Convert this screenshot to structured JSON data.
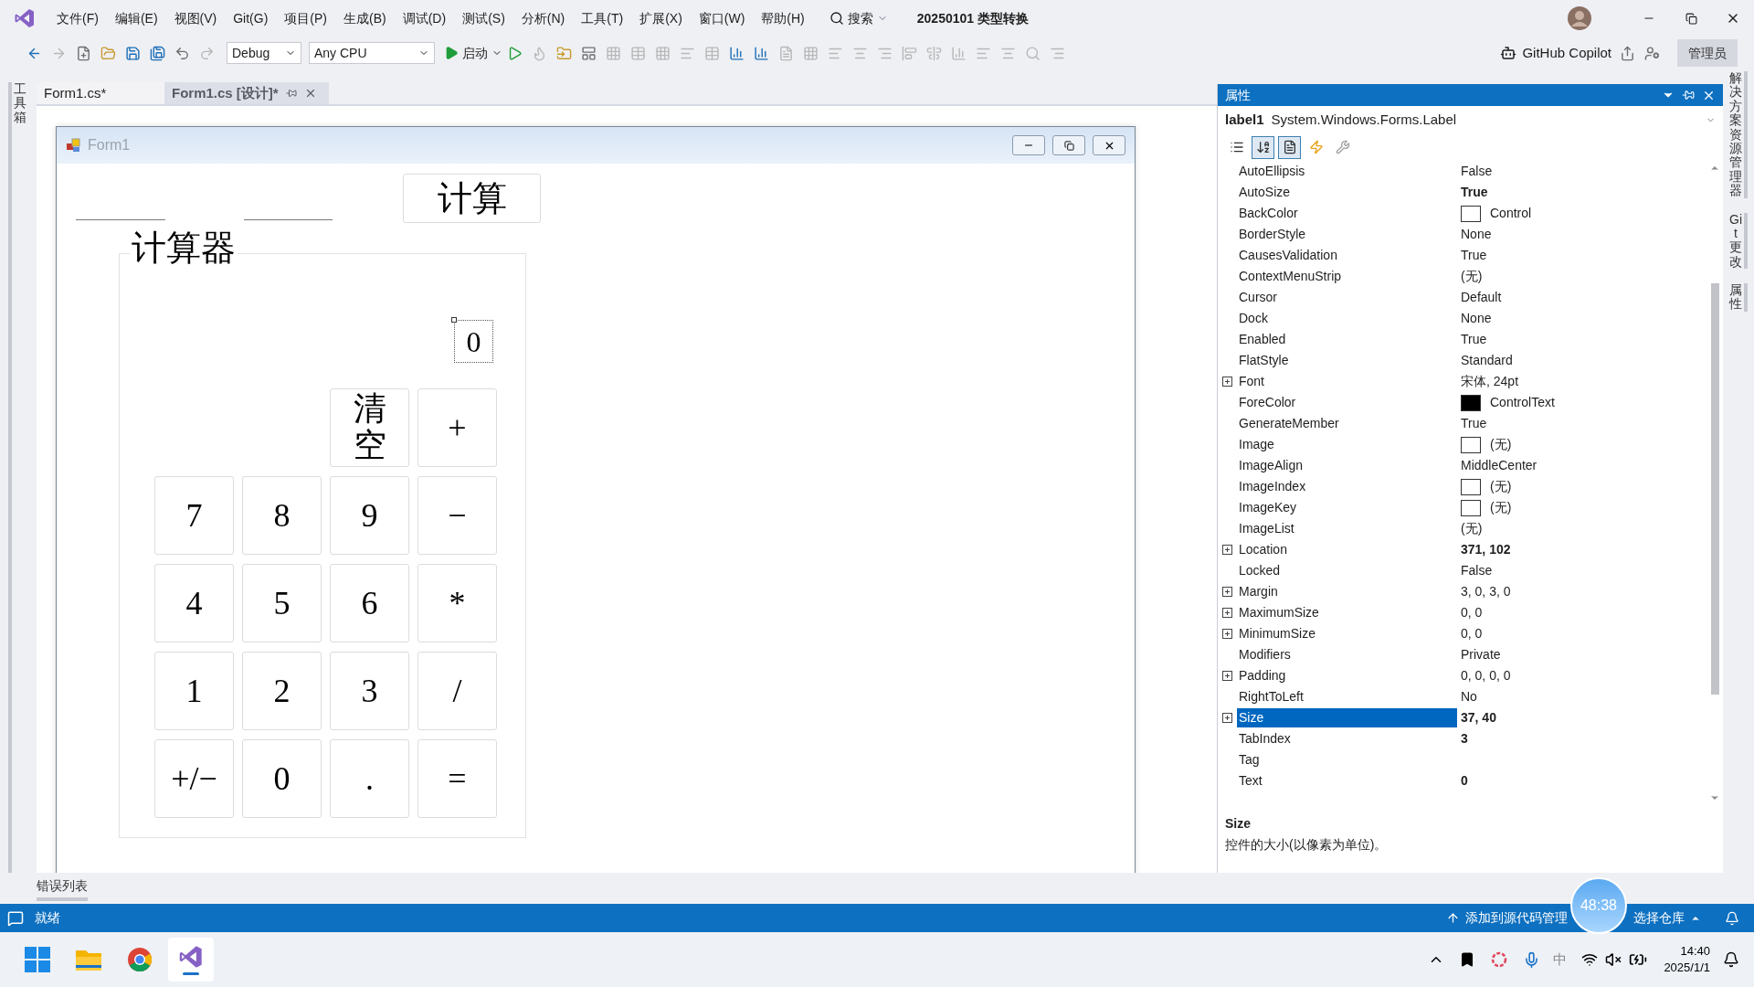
{
  "menu": [
    "文件(F)",
    "编辑(E)",
    "视图(V)",
    "Git(G)",
    "项目(P)",
    "生成(B)",
    "调试(D)",
    "测试(S)",
    "分析(N)",
    "工具(T)",
    "扩展(X)",
    "窗口(W)",
    "帮助(H)"
  ],
  "search": "搜索",
  "title": "20250101 类型转换",
  "admin": "管理员",
  "toolbar": {
    "config": "Debug",
    "platform": "Any CPU",
    "start": "启动",
    "copilot": "GitHub Copilot"
  },
  "left_strip": "工具箱",
  "doc_tabs": [
    {
      "label": "Form1.cs*",
      "selected": false
    },
    {
      "label": "Form1.cs [设计]*",
      "selected": true
    }
  ],
  "form": {
    "title": "Form1",
    "calc_button": "计算",
    "group_title": "计算器",
    "display": "0",
    "keypad": [
      [
        {
          "label": "清空",
          "kind": "word"
        },
        {
          "label": "+",
          "kind": "key"
        }
      ],
      [
        {
          "label": "7",
          "kind": "key"
        },
        {
          "label": "8",
          "kind": "key"
        },
        {
          "label": "9",
          "kind": "key"
        },
        {
          "label": "−",
          "kind": "key"
        }
      ],
      [
        {
          "label": "4",
          "kind": "key"
        },
        {
          "label": "5",
          "kind": "key"
        },
        {
          "label": "6",
          "kind": "key"
        },
        {
          "label": "*",
          "kind": "key"
        }
      ],
      [
        {
          "label": "1",
          "kind": "key"
        },
        {
          "label": "2",
          "kind": "key"
        },
        {
          "label": "3",
          "kind": "key"
        },
        {
          "label": "/",
          "kind": "key"
        }
      ],
      [
        {
          "label": "+/−",
          "kind": "key"
        },
        {
          "label": "0",
          "kind": "key"
        },
        {
          "label": ".",
          "kind": "key"
        },
        {
          "label": "=",
          "kind": "key"
        }
      ]
    ]
  },
  "properties": {
    "title": "属性",
    "object_name": "label1",
    "object_type": "System.Windows.Forms.Label",
    "view_buttons": [
      {
        "kind": "categorized",
        "selected": false
      },
      {
        "kind": "alphabetical",
        "selected": true
      },
      {
        "kind": "properties",
        "selected": true
      },
      {
        "kind": "events",
        "selected": false
      },
      {
        "kind": "property-pages",
        "selected": false
      }
    ],
    "rows": [
      {
        "name": "AutoEllipsis",
        "value": "False",
        "bold": false,
        "expandable": false,
        "selected": false
      },
      {
        "name": "AutoSize",
        "value": "True",
        "bold": true,
        "expandable": false,
        "selected": false
      },
      {
        "name": "BackColor",
        "value": "Control",
        "bold": false,
        "expandable": false,
        "selected": false,
        "color": "#ffffff"
      },
      {
        "name": "BorderStyle",
        "value": "None",
        "bold": false,
        "expandable": false,
        "selected": false
      },
      {
        "name": "CausesValidation",
        "value": "True",
        "bold": false,
        "expandable": false,
        "selected": false
      },
      {
        "name": "ContextMenuStrip",
        "value": "(无)",
        "bold": false,
        "expandable": false,
        "selected": false
      },
      {
        "name": "Cursor",
        "value": "Default",
        "bold": false,
        "expandable": false,
        "selected": false
      },
      {
        "name": "Dock",
        "value": "None",
        "bold": false,
        "expandable": false,
        "selected": false
      },
      {
        "name": "Enabled",
        "value": "True",
        "bold": false,
        "expandable": false,
        "selected": false
      },
      {
        "name": "FlatStyle",
        "value": "Standard",
        "bold": false,
        "expandable": false,
        "selected": false
      },
      {
        "name": "Font",
        "value": "宋体, 24pt",
        "bold": false,
        "expandable": true,
        "selected": false
      },
      {
        "name": "ForeColor",
        "value": "ControlText",
        "bold": false,
        "expandable": false,
        "selected": false,
        "color": "#000000"
      },
      {
        "name": "GenerateMember",
        "value": "True",
        "bold": false,
        "expandable": false,
        "selected": false
      },
      {
        "name": "Image",
        "value": "(无)",
        "bold": false,
        "expandable": false,
        "selected": false,
        "color": "#ffffff"
      },
      {
        "name": "ImageAlign",
        "value": "MiddleCenter",
        "bold": false,
        "expandable": false,
        "selected": false
      },
      {
        "name": "ImageIndex",
        "value": "(无)",
        "bold": false,
        "expandable": false,
        "selected": false,
        "color": "#ffffff"
      },
      {
        "name": "ImageKey",
        "value": "(无)",
        "bold": false,
        "expandable": false,
        "selected": false,
        "color": "#ffffff"
      },
      {
        "name": "ImageList",
        "value": "(无)",
        "bold": false,
        "expandable": false,
        "selected": false
      },
      {
        "name": "Location",
        "value": "371, 102",
        "bold": true,
        "expandable": true,
        "selected": false
      },
      {
        "name": "Locked",
        "value": "False",
        "bold": false,
        "expandable": false,
        "selected": false
      },
      {
        "name": "Margin",
        "value": "3, 0, 3, 0",
        "bold": false,
        "expandable": true,
        "selected": false
      },
      {
        "name": "MaximumSize",
        "value": "0, 0",
        "bold": false,
        "expandable": true,
        "selected": false
      },
      {
        "name": "MinimumSize",
        "value": "0, 0",
        "bold": false,
        "expandable": true,
        "selected": false
      },
      {
        "name": "Modifiers",
        "value": "Private",
        "bold": false,
        "expandable": false,
        "selected": false
      },
      {
        "name": "Padding",
        "value": "0, 0, 0, 0",
        "bold": false,
        "expandable": true,
        "selected": false
      },
      {
        "name": "RightToLeft",
        "value": "No",
        "bold": false,
        "expandable": false,
        "selected": false
      },
      {
        "name": "Size",
        "value": "37, 40",
        "bold": true,
        "expandable": true,
        "selected": true
      },
      {
        "name": "TabIndex",
        "value": "3",
        "bold": true,
        "expandable": false,
        "selected": false
      },
      {
        "name": "Tag",
        "bold": false,
        "expandable": false,
        "selected": false
      },
      {
        "name": "Text",
        "value": "0",
        "bold": true,
        "expandable": false,
        "selected": false
      }
    ],
    "help_title": "Size",
    "help_text": "控件的大小(以像素为单位)。"
  },
  "right_strip": [
    "解决方案资源管理器",
    "Git 更改",
    "属性"
  ],
  "error_tab": "错误列表",
  "status_bar": {
    "state": "就绪",
    "source_control": "添加到源代码管理",
    "repo": "选择仓库",
    "timer": "48:38"
  },
  "taskbar": {
    "ime": "中",
    "time": "14:40",
    "date": "2025/1/1"
  }
}
